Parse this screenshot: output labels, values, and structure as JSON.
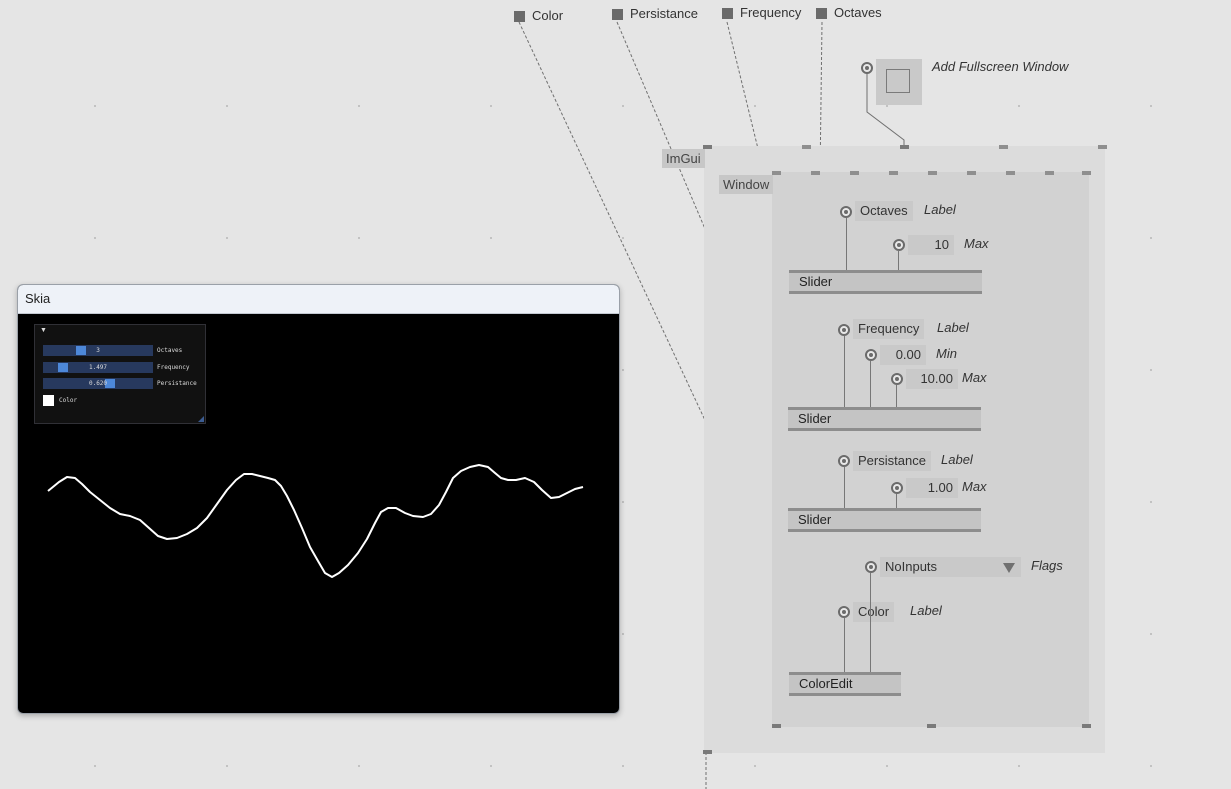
{
  "top_pads": {
    "color": "Color",
    "persistance": "Persistance",
    "frequency": "Frequency",
    "octaves": "Octaves"
  },
  "fullscreen": {
    "label": "Add Fullscreen Window"
  },
  "imgui": {
    "tag": "ImGui"
  },
  "window": {
    "tag": "Window"
  },
  "slider_octaves": {
    "label_value": "Octaves",
    "label_pin": "Label",
    "max_value": "10",
    "max_pin": "Max",
    "node": "Slider"
  },
  "slider_frequency": {
    "label_value": "Frequency",
    "label_pin": "Label",
    "min_value": "0.00",
    "min_pin": "Min",
    "max_value": "10.00",
    "max_pin": "Max",
    "node": "Slider"
  },
  "slider_persistance": {
    "label_value": "Persistance",
    "label_pin": "Label",
    "max_value": "1.00",
    "max_pin": "Max",
    "node": "Slider"
  },
  "coloredit": {
    "flags_value": "NoInputs",
    "flags_pin": "Flags",
    "label_value": "Color",
    "label_pin": "Label",
    "node": "ColorEdit"
  },
  "skia": {
    "title": "Skia",
    "panel": {
      "sliders": [
        {
          "value": "3",
          "label": "Octaves",
          "fraction": 0.33
        },
        {
          "value": "1.497",
          "label": "Frequency",
          "fraction": 0.15
        },
        {
          "value": "0.620",
          "label": "Persistance",
          "fraction": 0.62
        }
      ],
      "color_label": "Color",
      "color_value": "#ffffff"
    }
  },
  "colors": {
    "link_highlight": "#f0b429",
    "canvas_bg": "#e5e5e5",
    "skia_bg": "#000000",
    "slider_frame": "#27395e",
    "slider_grab": "#4d88d9"
  }
}
